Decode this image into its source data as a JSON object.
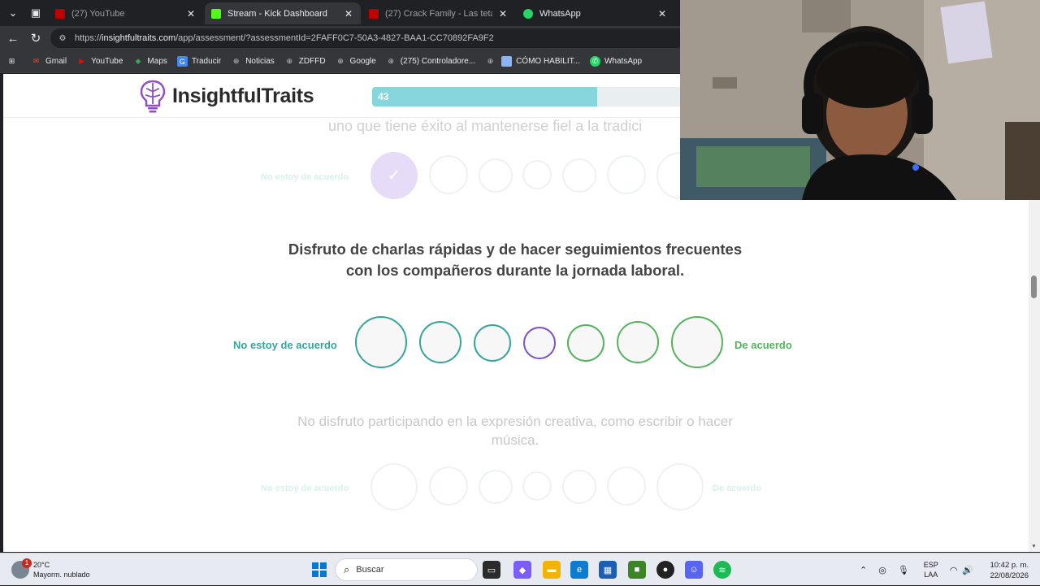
{
  "browser": {
    "tabs": [
      {
        "label": "(27) YouTube",
        "color": "#c00000",
        "active": false
      },
      {
        "label": "Stream - Kick Dashboard",
        "color": "#53fc18",
        "active": true
      },
      {
        "label": "(27) Crack Family - Las tetas de m",
        "color": "#c00000",
        "active": false
      },
      {
        "label": "WhatsApp",
        "color": "#25d366",
        "active": false
      }
    ],
    "url_prefix": "https://",
    "url_domain": "insightfultraits.com",
    "url_path": "/app/assessment/?assessmentId=2FAFF0C7-50A3-4827-BAA1-CC70892FA9F2",
    "bookmarks": [
      {
        "label": "Gmail",
        "icon": "gmail-icon",
        "color": "#ea4335"
      },
      {
        "label": "YouTube",
        "icon": "youtube-icon",
        "color": "#ff0000"
      },
      {
        "label": "Maps",
        "icon": "maps-icon",
        "color": "#34a853"
      },
      {
        "label": "Traducir",
        "icon": "translate-icon",
        "color": "#4285f4"
      },
      {
        "label": "Noticias",
        "icon": "globe-icon",
        "color": "#9aa0a6"
      },
      {
        "label": "ZDFFD",
        "icon": "globe-icon",
        "color": "#9aa0a6"
      },
      {
        "label": "Google",
        "icon": "globe-icon",
        "color": "#9aa0a6"
      },
      {
        "label": "(275) Controladore...",
        "icon": "globe-icon",
        "color": "#9aa0a6"
      },
      {
        "label": "",
        "icon": "globe-icon",
        "color": "#9aa0a6"
      },
      {
        "label": "CÓMO HABILIT...",
        "icon": "page-icon",
        "color": "#8ab4f8"
      },
      {
        "label": "WhatsApp",
        "icon": "whatsapp-icon",
        "color": "#25d366"
      }
    ]
  },
  "site": {
    "brand": "InsightfulTraits",
    "progress_label": "43",
    "progress_fraction": 0.66,
    "accent": "#85d6dd"
  },
  "questions": {
    "previous_text": "uno que tiene éxito al mantenerse fiel a la tradici",
    "previous_left_label": "No estoy de acuerdo",
    "current_text": "Disfruto de charlas rápidas y de hacer seguimientos frecuentes con los compañeros durante la jornada laboral.",
    "current_left_label": "No estoy de acuerdo",
    "current_right_label": "De acuerdo",
    "next_text": "No disfruto participando en la expresión creativa, como escribir o hacer música.",
    "next_left_label": "No estoy de acuerdo",
    "next_right_label": "De acuerdo",
    "colors": {
      "disagree": "#36a59b",
      "neutral": "#7e52c4",
      "agree": "#55b35e"
    }
  },
  "taskbar": {
    "temperature": "20°C",
    "weather": "Mayorm. nublado",
    "weather_badge": "1",
    "search_placeholder": "Buscar",
    "language_1": "ESP",
    "language_2": "LAA",
    "time": "10:42 p. m.",
    "date": "22/08/2026"
  }
}
